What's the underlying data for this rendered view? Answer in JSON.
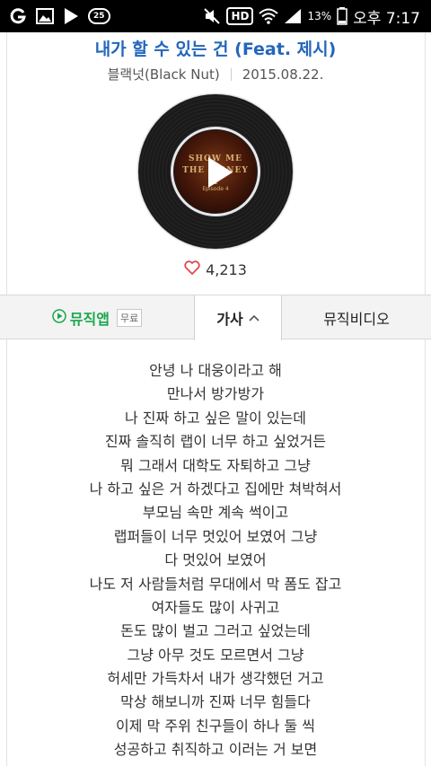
{
  "status_bar": {
    "badge": "25",
    "hd": "HD",
    "battery": "13%",
    "time": "오후 7:17"
  },
  "song": {
    "title": "내가 할 수 있는 건 (Feat. 제시)",
    "artist": "블랙넛(Black Nut)",
    "date": "2015.08.22."
  },
  "album_cover": {
    "text": "SHOW ME THE MONEY 4",
    "sub": "Episode 4"
  },
  "likes": {
    "count": "4,213"
  },
  "tabs": {
    "music_app": "뮤직앱",
    "free": "무료",
    "lyrics": "가사",
    "music_video": "뮤직비디오"
  },
  "lyrics": [
    "안녕 나 대웅이라고 해",
    "만나서 방가방가",
    "나 진짜 하고 싶은 말이 있는데",
    "진짜 솔직히 랩이 너무 하고 싶었거든",
    "뭐 그래서 대학도 자퇴하고 그냥",
    "나 하고 싶은 거 하겠다고 집에만 쳐박혀서",
    "부모님 속만 계속 썩이고",
    "랩퍼들이 너무 멋있어 보였어 그냥",
    "다 멋있어 보였어",
    "나도 저 사람들처럼 무대에서 막 폼도 잡고",
    "여자들도 많이 사귀고",
    "돈도 많이 벌고 그러고 싶었는데",
    "그냥 아무 것도 모르면서 그냥",
    "허세만 가득차서 내가 생각했던 거고",
    "막상 해보니까 진짜 너무 힘들다",
    "이제 막 주위 친구들이 하나 둘 씩",
    "성공하고 취직하고 이러는 거 보면"
  ],
  "colors": {
    "title": "#2266bb",
    "music_app_green": "#1aa84a",
    "heart": "#e2474b"
  }
}
